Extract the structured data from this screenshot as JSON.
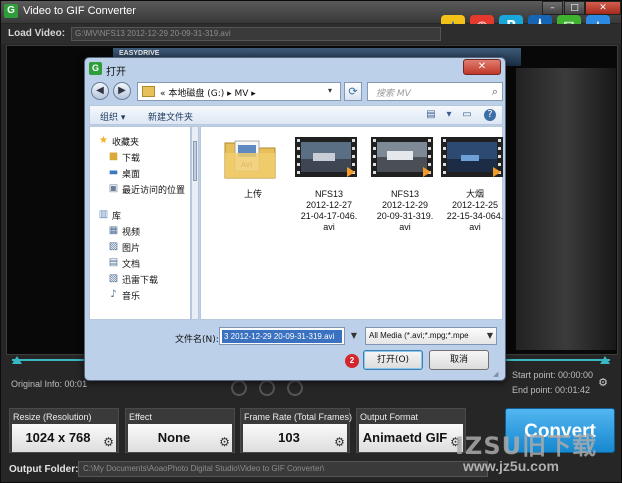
{
  "app": {
    "title": "Video to GIF Converter",
    "icon_letter": "G",
    "window_buttons": [
      "–",
      "□",
      "✕"
    ],
    "social_icons": [
      "qzone-icon",
      "weibo-icon",
      "pengyou-icon",
      "renren-icon",
      "wechat-icon",
      "more-icon"
    ],
    "load_video_label": "Load Video:",
    "load_video_path": "G:\\MV\\NFS13 2012-12-29 20-09-31-319.avi",
    "video_badge": "EASYDRIVE",
    "original_info_label": "Original Info:",
    "original_info_value": "00:01",
    "start_point": "Start point: 00:00:00",
    "end_point": "End point: 00:01:42",
    "options": {
      "resize": {
        "label": "Resize (Resolution)",
        "value": "1024 x 768"
      },
      "effect": {
        "label": "Effect",
        "value": "None"
      },
      "frame_rate": {
        "label": "Frame Rate (Total Frames)",
        "value": "103"
      },
      "output_format": {
        "label": "Output Format",
        "value": "Animaetd GIF"
      }
    },
    "convert_label": "Convert",
    "output_folder_label": "Output Folder:",
    "output_folder_path": "C:\\My Documents\\AoaoPhoto Digital Studio\\Video to GIF Converter\\"
  },
  "watermark": {
    "main": "IZSU旧下载",
    "url": "www.jz5u.com"
  },
  "dialog": {
    "title": "打开",
    "icon_letter": "G",
    "close_label": "✕",
    "address_path": "« 本地磁盘 (G:) ▸ MV ▸",
    "search_placeholder": "搜索 MV",
    "organize_label": "组织 ▾",
    "new_folder_label": "新建文件夹",
    "help_label": "?",
    "nav": {
      "favorites_header": "收藏夹",
      "favorites": [
        "下载",
        "桌面",
        "最近访问的位置"
      ],
      "library_header": "库",
      "libraries": [
        "视频",
        "图片",
        "文档",
        "迅雷下载",
        "音乐"
      ]
    },
    "files": [
      {
        "name": "上传",
        "kind": "folder"
      },
      {
        "name": "NFS13\n2012-12-27\n21-04-17-046.\navi",
        "kind": "video"
      },
      {
        "name": "NFS13\n2012-12-29\n20-09-31-319.\navi",
        "kind": "video"
      },
      {
        "name": "大烟\n2012-12-25\n22-15-34-064.\navi",
        "kind": "video"
      }
    ],
    "filename_label": "文件名(N):",
    "filename_value": "3 2012-12-29 20-09-31-319.avi",
    "filetype_value": "All Media (*.avi;*.mpg;*.mpe",
    "open_label": "打开(O)",
    "cancel_label": "取消",
    "step_badge": "2"
  },
  "colors": {
    "accent": "#38b7c5",
    "convert": "#1f8fd6",
    "app_bg": "#262626",
    "dialog_frame": "#bcd0e9",
    "badge": "#d4262c"
  }
}
